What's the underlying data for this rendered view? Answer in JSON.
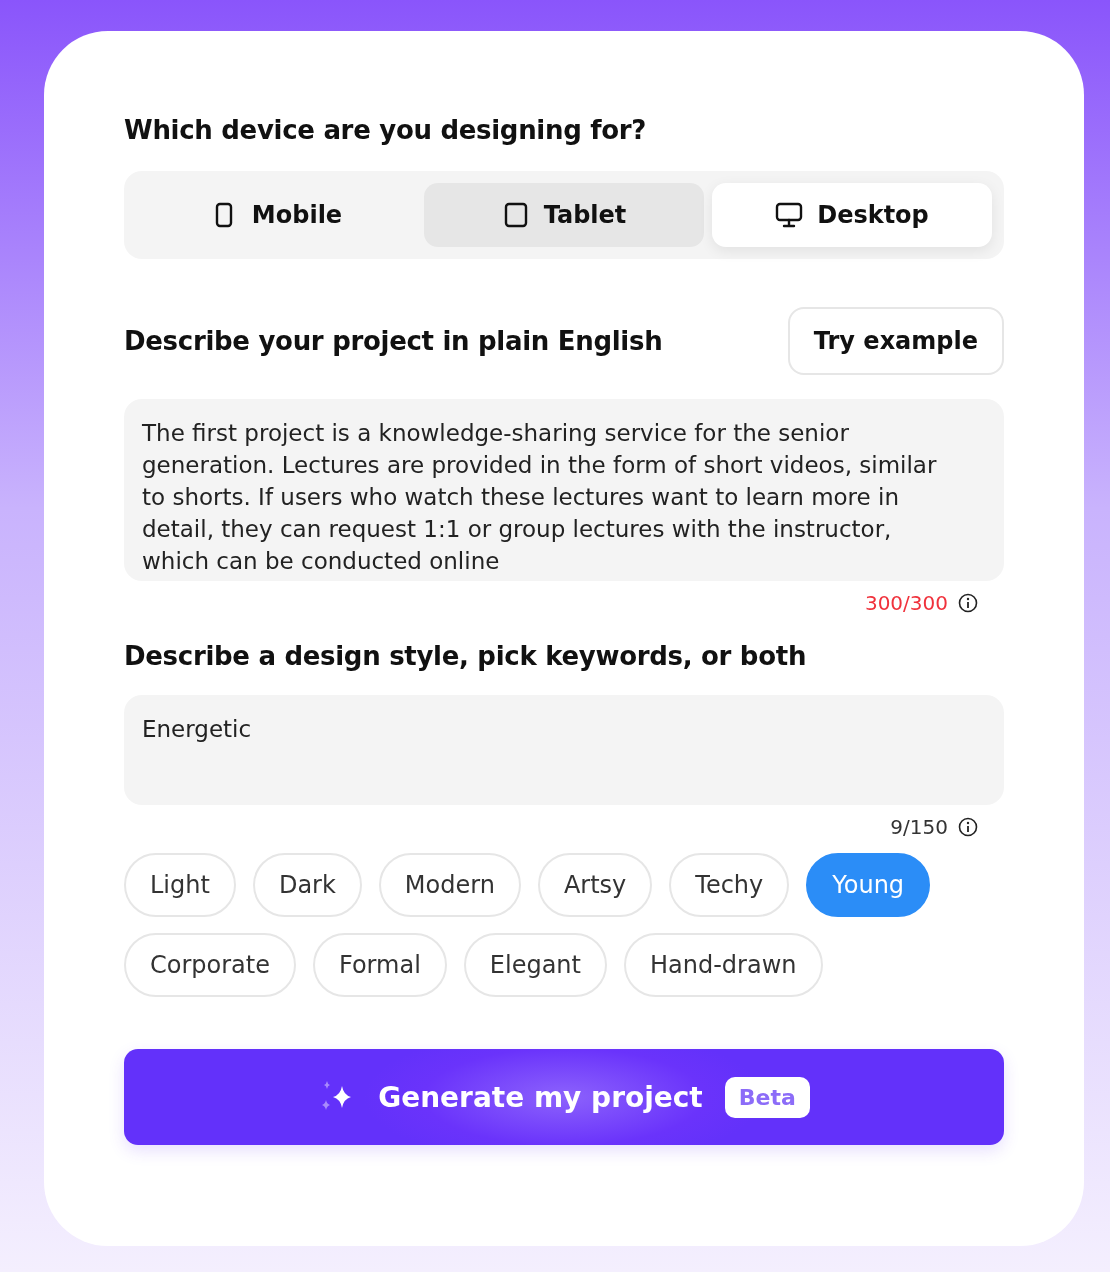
{
  "device_question": "Which device are you designing for?",
  "devices": [
    {
      "kind": "mobile",
      "label": "Mobile",
      "selected": false,
      "hovered": false
    },
    {
      "kind": "tablet",
      "label": "Tablet",
      "selected": false,
      "hovered": true
    },
    {
      "kind": "desktop",
      "label": "Desktop",
      "selected": true,
      "hovered": false
    }
  ],
  "project": {
    "heading": "Describe your project in plain English",
    "example_button": "Try example",
    "value": "The first project is a knowledge-sharing service for the senior generation. Lectures are provided in the form of short videos, similar to shorts. If users who watch these lectures want to learn more in detail, they can request 1:1 or group lectures with the instructor, which can be conducted online",
    "counter": "300/300",
    "limit_reached": true
  },
  "style": {
    "heading": "Describe a design style, pick keywords, or both",
    "value": "Energetic",
    "counter": "9/150",
    "limit_reached": false
  },
  "keywords": [
    {
      "label": "Light",
      "selected": false
    },
    {
      "label": "Dark",
      "selected": false
    },
    {
      "label": "Modern",
      "selected": false
    },
    {
      "label": "Artsy",
      "selected": false
    },
    {
      "label": "Techy",
      "selected": false
    },
    {
      "label": "Young",
      "selected": true
    },
    {
      "label": "Corporate",
      "selected": false
    },
    {
      "label": "Formal",
      "selected": false
    },
    {
      "label": "Elegant",
      "selected": false
    },
    {
      "label": "Hand-drawn",
      "selected": false
    }
  ],
  "generate_button": {
    "label": "Generate my project",
    "badge": "Beta"
  }
}
